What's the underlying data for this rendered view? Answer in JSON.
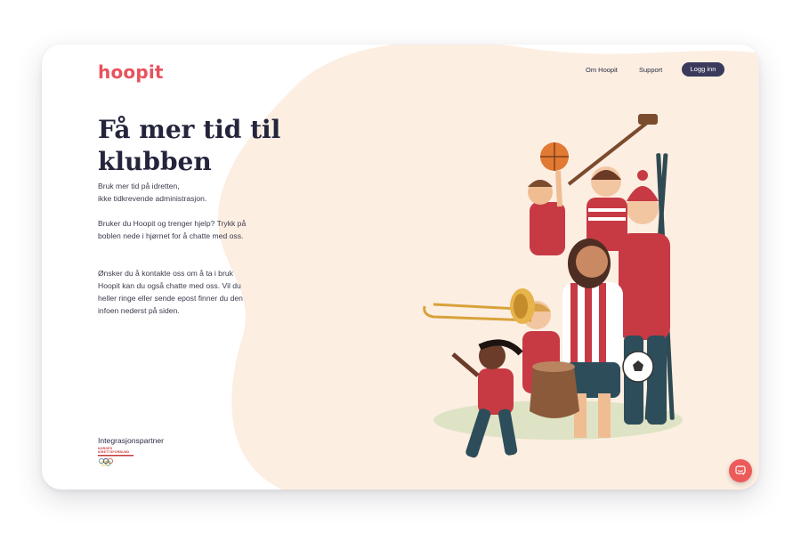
{
  "app": {
    "logo": "hoopit",
    "brand_color": "#e8525c",
    "dark_color": "#24243d",
    "blob_color": "#fdeee2"
  },
  "nav": {
    "about_label": "Om Hoopit",
    "support_label": "Support",
    "login_label": "Logg inn"
  },
  "hero": {
    "title_line1": "Få mer tid til",
    "title_line2": "klubben",
    "p1_line1": "Bruk mer tid på idretten,",
    "p1_line2": "ikke tidkrevende administrasjon.",
    "p2": "Bruker du Hoopit og trenger hjelp? Trykk på boblen nede i hjørnet for å chatte med oss.",
    "p3": "Ønsker du å kontakte oss om å ta i bruk Hoopit kan du også chatte med oss. Vil du heller ringe eller sende epost finner du den infoen nederst på siden."
  },
  "partner": {
    "label": "Integrasjonspartner",
    "logo_text_1": "NORGES",
    "logo_text_2": "IDRETTSFORBUND"
  },
  "chat": {
    "icon": "chat-bubble-icon"
  }
}
